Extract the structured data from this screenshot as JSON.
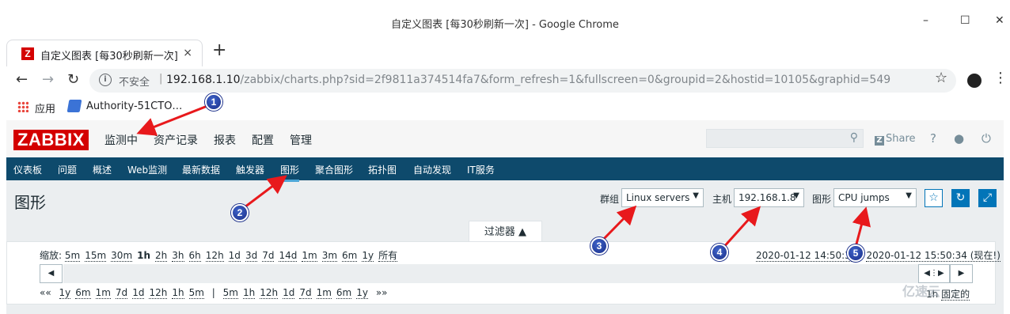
{
  "window": {
    "title": "自定义图表 [每30秒刷新一次] - Google Chrome",
    "controls": [
      "–",
      "☐",
      "✕"
    ]
  },
  "tab": {
    "favicon": "Z",
    "title": "自定义图表 [每30秒刷新一次]",
    "close": "×",
    "new_tab": "+"
  },
  "addressbar": {
    "security_label": "不安全",
    "separator": "|",
    "host": "192.168.1.10",
    "path": "/zabbix/charts.php?sid=2f9811a374514fa7&form_refresh=1&fullscreen=0&groupid=2&hostid=10105&graphid=549"
  },
  "bookmarks": {
    "apps": "应用",
    "items": [
      "Authority-51CTO…"
    ]
  },
  "zabbix": {
    "logo": "ZABBIX",
    "top_menu": [
      "监测中",
      "资产记录",
      "报表",
      "配置",
      "管理"
    ],
    "share": "Share",
    "help": "?",
    "sub_menu": [
      "仪表板",
      "问题",
      "概述",
      "Web监测",
      "最新数据",
      "触发器",
      "图形",
      "聚合图形",
      "拓扑图",
      "自动发现",
      "IT服务"
    ],
    "active_sub": "图形",
    "page_title": "图形",
    "filters": {
      "group_label": "群组",
      "group_value": "Linux servers",
      "host_label": "主机",
      "host_value": "192.168.1.8",
      "graph_label": "图形",
      "graph_value": "CPU jumps"
    },
    "filter_tab": "过滤器 ▲",
    "zoom_label": "缩放:",
    "zoom": [
      "5m",
      "15m",
      "30m",
      "1h",
      "2h",
      "3h",
      "6h",
      "12h",
      "1d",
      "3d",
      "7d",
      "14d",
      "1m",
      "3m",
      "6m",
      "1y",
      "所有"
    ],
    "zoom_selected": "1h",
    "range_from": "2020-01-12 14:50:34",
    "range_sep": "-",
    "range_to": "2020-01-12 15:50:34 (现在!)",
    "period_back": "««",
    "period_left": [
      "1y",
      "6m",
      "1m",
      "7d",
      "1d",
      "12h",
      "1h",
      "5m"
    ],
    "period_sep": "|",
    "period_right": [
      "5m",
      "1h",
      "12h",
      "1d",
      "7d",
      "1m",
      "6m",
      "1y"
    ],
    "period_forward": "»»",
    "period_current": "1h",
    "period_fixed": "固定的"
  },
  "annotations": [
    "1",
    "2",
    "3",
    "4",
    "5"
  ],
  "colors": {
    "zabbix_red": "#d40000",
    "subnav_bg": "#0e4a6c",
    "accent_blue": "#0275b8",
    "arrow_red": "#e8191c"
  },
  "watermark": "亿速云"
}
